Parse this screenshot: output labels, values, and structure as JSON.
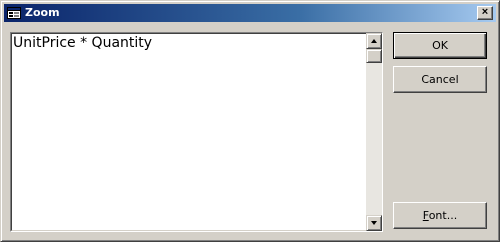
{
  "window": {
    "title": "Zoom",
    "close_glyph": "×"
  },
  "editor": {
    "value": "UnitPrice * Quantity"
  },
  "buttons": {
    "ok_label": "OK",
    "cancel_label": "Cancel",
    "font_label_accel": "F",
    "font_label_rest": "ont..."
  },
  "icons": {
    "title": "form-window-icon",
    "scroll_up": "arrow-up-icon",
    "scroll_down": "arrow-down-icon"
  }
}
